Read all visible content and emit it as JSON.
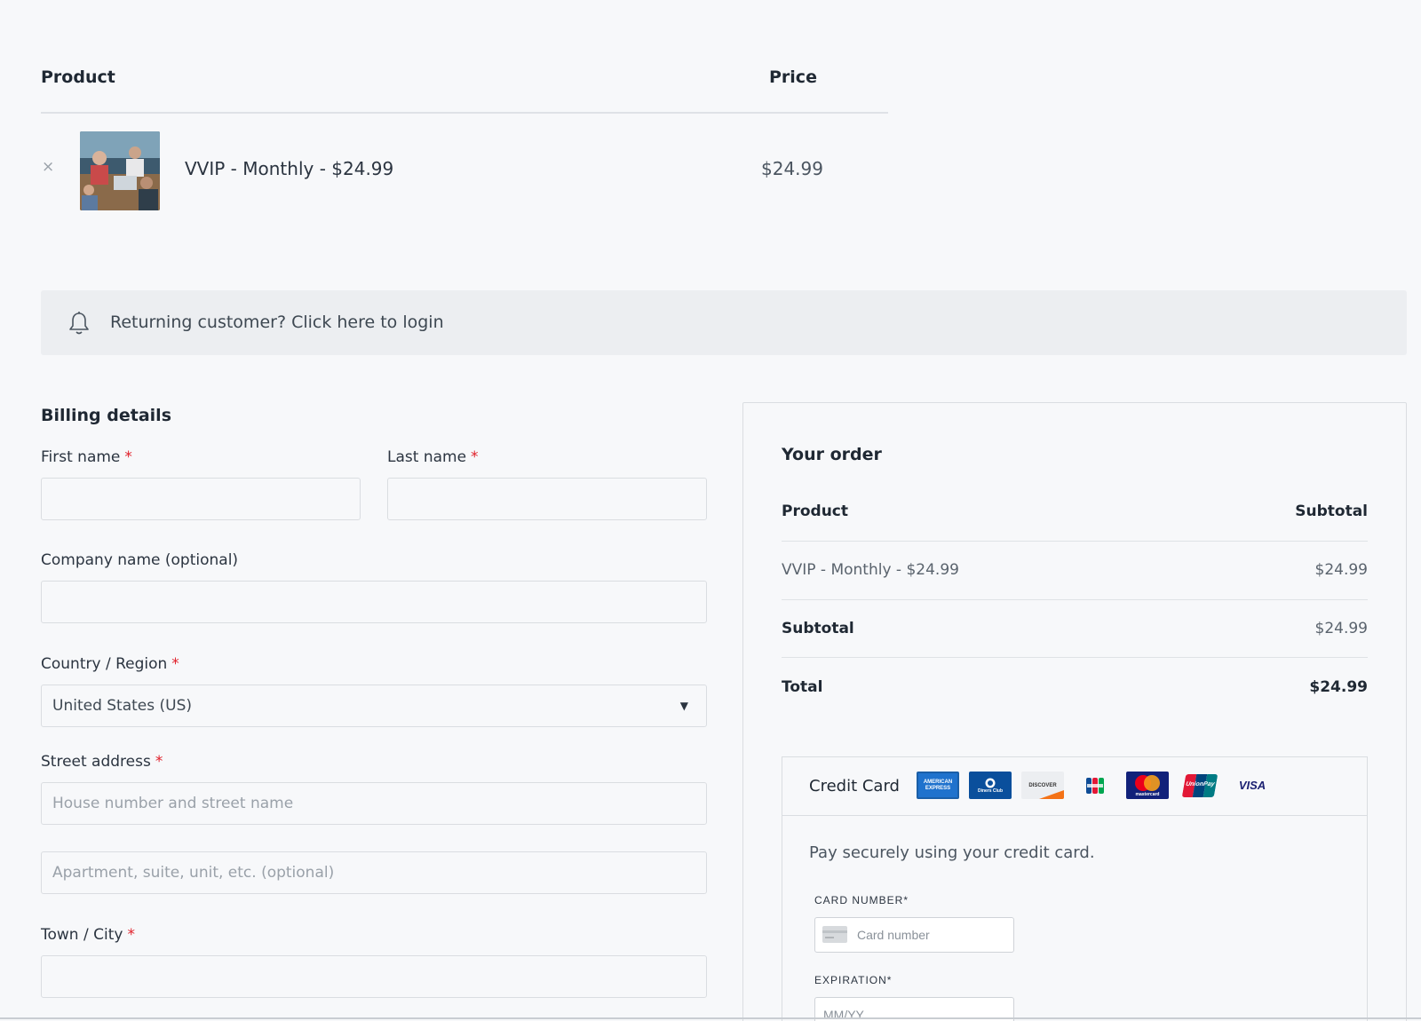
{
  "cart": {
    "header_product": "Product",
    "header_price": "Price",
    "remove_glyph": "×",
    "item_name": "VVIP - Monthly - $24.99",
    "item_price": "$24.99"
  },
  "notice": {
    "icon": "bell-icon",
    "text": "Returning customer? Click here to login"
  },
  "billing": {
    "title": "Billing details",
    "required_mark": "*",
    "first_name_label": "First name",
    "last_name_label": "Last name",
    "company_label": "Company name (optional)",
    "country_label": "Country / Region",
    "country_value": "United States (US)",
    "street_label": "Street address",
    "street_placeholder": "House number and street name",
    "apartment_placeholder": "Apartment, suite, unit, etc. (optional)",
    "city_label": "Town / City"
  },
  "order": {
    "title": "Your order",
    "col_product": "Product",
    "col_subtotal": "Subtotal",
    "item_name": "VVIP - Monthly - $24.99",
    "item_price": "$24.99",
    "subtotal_label": "Subtotal",
    "subtotal_value": "$24.99",
    "total_label": "Total",
    "total_value": "$24.99"
  },
  "payment": {
    "method_label": "Credit Card",
    "description": "Pay securely using your credit card.",
    "card_number_label": "CARD NUMBER*",
    "card_number_placeholder": "Card number",
    "expiration_label": "EXPIRATION*",
    "expiration_placeholder": "MM/YY",
    "brands": {
      "amex": "AMERICAN EXPRESS",
      "diners": "Diners Club",
      "discover": "DISCOVER",
      "jcb": "JCB",
      "mastercard": "mastercard",
      "unionpay": "UnionPay",
      "visa": "VISA"
    }
  },
  "colors": {
    "background": "#f7f8fa",
    "required": "#e0202a",
    "notice_bg": "#eceef1"
  }
}
